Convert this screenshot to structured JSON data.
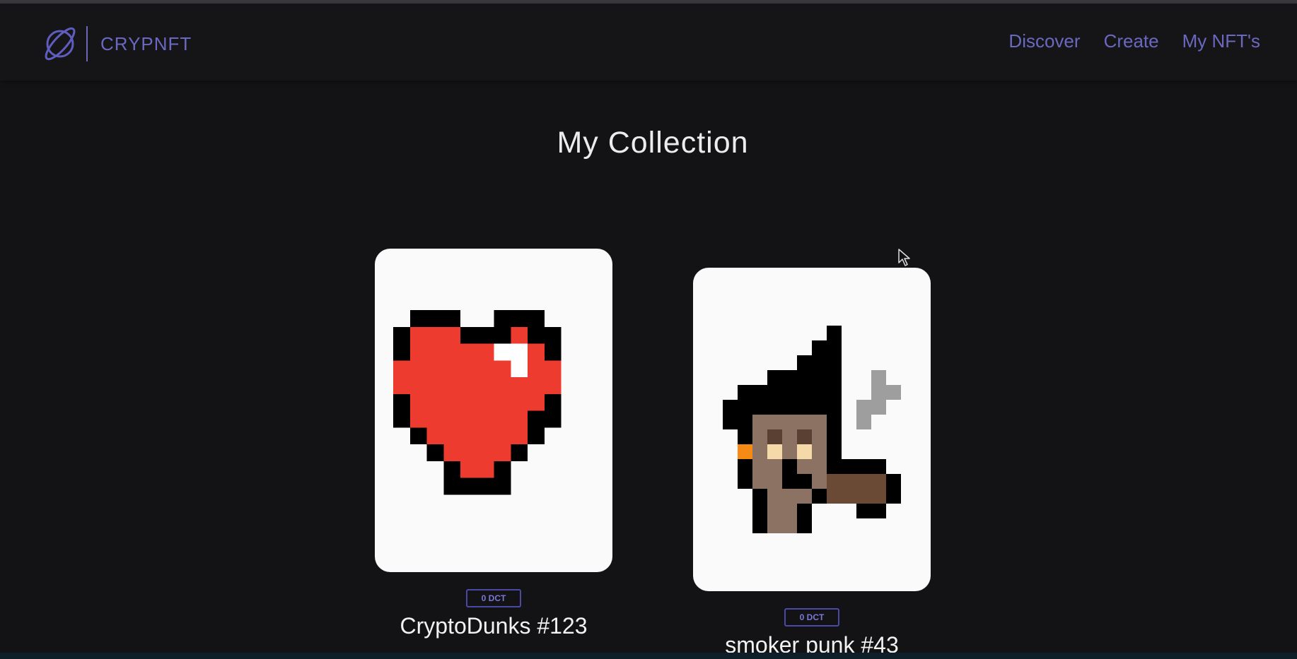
{
  "app": {
    "brand": "CRYPNFT",
    "logo_icon": "planet-icon",
    "accent_color": "#6a68c0"
  },
  "nav": {
    "links": [
      {
        "label": "Discover"
      },
      {
        "label": "Create"
      },
      {
        "label": "My NFT's"
      }
    ]
  },
  "page": {
    "title": "My Collection"
  },
  "collection": [
    {
      "name": "CryptoDunks #123",
      "price": "0 DCT",
      "image_icon": "pixel-heart-image"
    },
    {
      "name": "smoker punk #43",
      "price": "0 DCT",
      "image_icon": "pixel-smoker-punk-image"
    }
  ],
  "cursor_icon": "mouse-pointer-icon"
}
